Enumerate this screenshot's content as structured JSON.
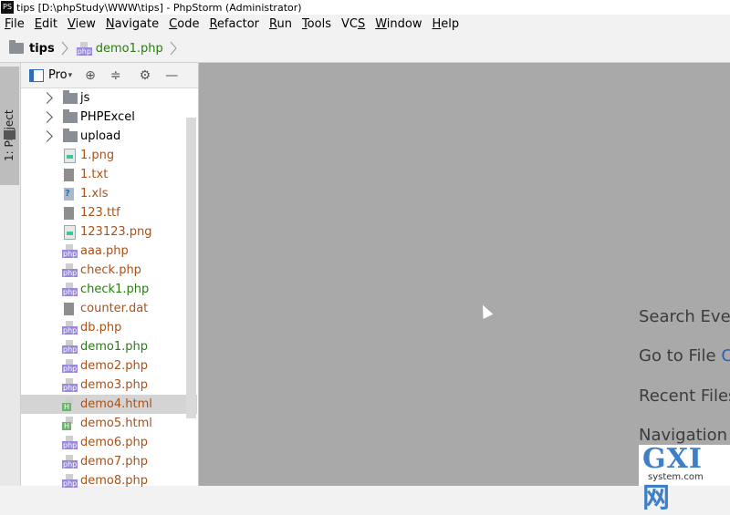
{
  "window": {
    "title": "tips [D:\\phpStudy\\WWW\\tips] - PhpStorm (Administrator)",
    "app_icon": "PS"
  },
  "menu": [
    {
      "u": "F",
      "rest": "ile"
    },
    {
      "u": "E",
      "rest": "dit"
    },
    {
      "u": "V",
      "rest": "iew"
    },
    {
      "u": "N",
      "rest": "avigate"
    },
    {
      "u": "C",
      "rest": "ode"
    },
    {
      "u": "R",
      "rest": "efactor"
    },
    {
      "u": "R",
      "rest": "un"
    },
    {
      "u": "T",
      "rest": "ools"
    },
    {
      "pre": "VC",
      "u": "S",
      "rest": ""
    },
    {
      "u": "W",
      "rest": "indow"
    },
    {
      "u": "H",
      "rest": "elp"
    }
  ],
  "breadcrumb": {
    "project": "tips",
    "file": "demo1.php"
  },
  "toolstrip": {
    "tab_label": "1: Project"
  },
  "project_panel": {
    "title": "Pro"
  },
  "tree": [
    {
      "name": "js",
      "kind": "dir",
      "color": "black",
      "expandable": true
    },
    {
      "name": "PHPExcel",
      "kind": "dir",
      "color": "black",
      "expandable": true
    },
    {
      "name": "upload",
      "kind": "dir",
      "color": "black",
      "expandable": true
    },
    {
      "name": "1.png",
      "kind": "img",
      "color": "brown"
    },
    {
      "name": "1.txt",
      "kind": "txt",
      "color": "brown"
    },
    {
      "name": "1.xls",
      "kind": "xls",
      "color": "brown"
    },
    {
      "name": "123.ttf",
      "kind": "txt",
      "color": "brown"
    },
    {
      "name": "123123.png",
      "kind": "img",
      "color": "brown"
    },
    {
      "name": "aaa.php",
      "kind": "php",
      "color": "brown"
    },
    {
      "name": "check.php",
      "kind": "php",
      "color": "brown"
    },
    {
      "name": "check1.php",
      "kind": "php",
      "color": "green"
    },
    {
      "name": "counter.dat",
      "kind": "txt",
      "color": "brown"
    },
    {
      "name": "db.php",
      "kind": "php",
      "color": "brown"
    },
    {
      "name": "demo1.php",
      "kind": "php",
      "color": "green"
    },
    {
      "name": "demo2.php",
      "kind": "php",
      "color": "brown"
    },
    {
      "name": "demo3.php",
      "kind": "php",
      "color": "brown"
    },
    {
      "name": "demo4.html",
      "kind": "html",
      "color": "brown",
      "selected": true
    },
    {
      "name": "demo5.html",
      "kind": "html",
      "color": "brown"
    },
    {
      "name": "demo6.php",
      "kind": "php",
      "color": "brown"
    },
    {
      "name": "demo7.php",
      "kind": "php",
      "color": "brown"
    },
    {
      "name": "demo8.php",
      "kind": "php",
      "color": "brown"
    }
  ],
  "editor_hints": [
    {
      "text": "Search Every",
      "key": ""
    },
    {
      "text": "Go to File ",
      "key": "Ct"
    },
    {
      "text": "Recent Files",
      "key": ""
    },
    {
      "text": "Navigation B",
      "key": ""
    }
  ],
  "watermark": {
    "big": "GXI网",
    "small": "system.com"
  },
  "colors": {
    "editor_bg": "#a9a9a9",
    "vcs_green": "#297c13",
    "vcs_brown": "#a8511a",
    "selection": "#d4d4d4"
  }
}
